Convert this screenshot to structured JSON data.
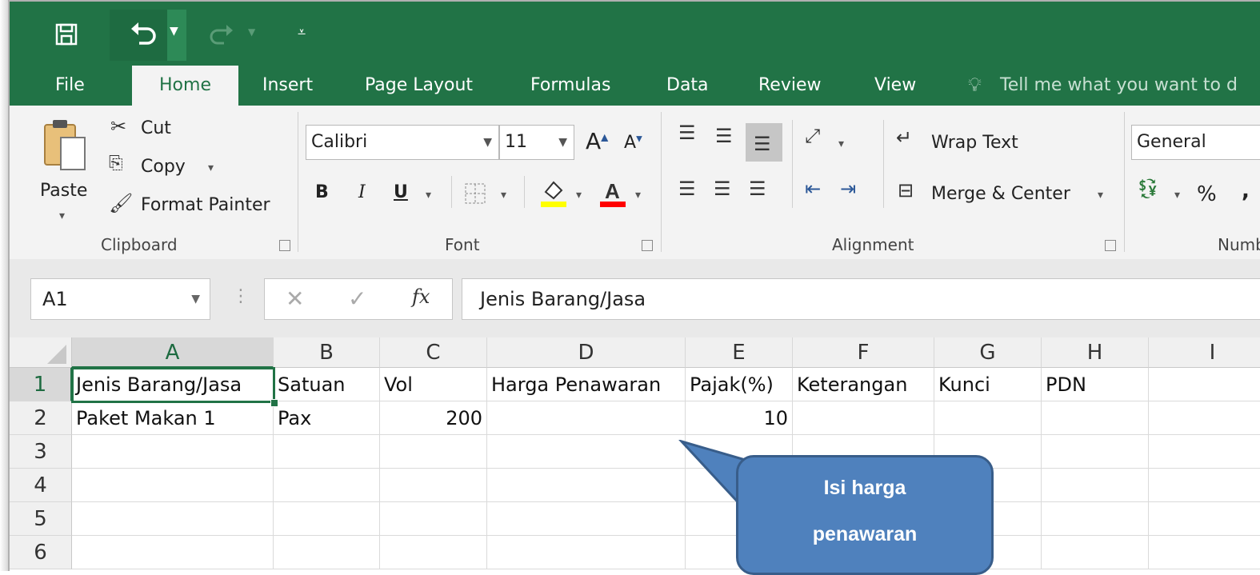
{
  "quick_access": {
    "save_icon": "save-icon",
    "undo_icon": "undo-icon",
    "redo_icon": "redo-icon",
    "customize_icon": "customize-qat-icon"
  },
  "tabs": [
    "File",
    "Home",
    "Insert",
    "Page Layout",
    "Formulas",
    "Data",
    "Review",
    "View"
  ],
  "active_tab": "Home",
  "tell_me": "Tell me what you want to d",
  "clipboard": {
    "paste": "Paste",
    "cut": "Cut",
    "copy": "Copy",
    "format_painter": "Format Painter",
    "group": "Clipboard"
  },
  "font": {
    "name": "Calibri",
    "size": "11",
    "bold": "B",
    "italic": "I",
    "underline": "U",
    "grow": "A",
    "shrink": "A",
    "group": "Font",
    "highlight_color": "#ffff00",
    "font_color": "#ff0000"
  },
  "alignment": {
    "wrap_text": "Wrap Text",
    "merge_center": "Merge & Center",
    "group": "Alignment"
  },
  "number": {
    "format": "General",
    "percent": "%",
    "group": "Numb"
  },
  "formula_bar": {
    "name_box": "A1",
    "fx": "fx",
    "value": "Jenis Barang/Jasa"
  },
  "columns": [
    "A",
    "B",
    "C",
    "D",
    "E",
    "F",
    "G",
    "H",
    "I"
  ],
  "rows": [
    "1",
    "2",
    "3",
    "4",
    "5",
    "6"
  ],
  "cells": {
    "A1": "Jenis Barang/Jasa",
    "B1": "Satuan",
    "C1": "Vol",
    "D1": "Harga Penawaran",
    "E1": "Pajak(%)",
    "F1": "Keterangan",
    "G1": "Kunci",
    "H1": "PDN",
    "A2": "Paket Makan 1",
    "B2": "Pax",
    "C2": "200",
    "E2": "10"
  },
  "callout": {
    "line1": "Isi harga",
    "line2": "penawaran"
  },
  "colors": {
    "excel_green": "#217346",
    "callout_fill": "#4f81bd",
    "callout_border": "#385d8a"
  }
}
